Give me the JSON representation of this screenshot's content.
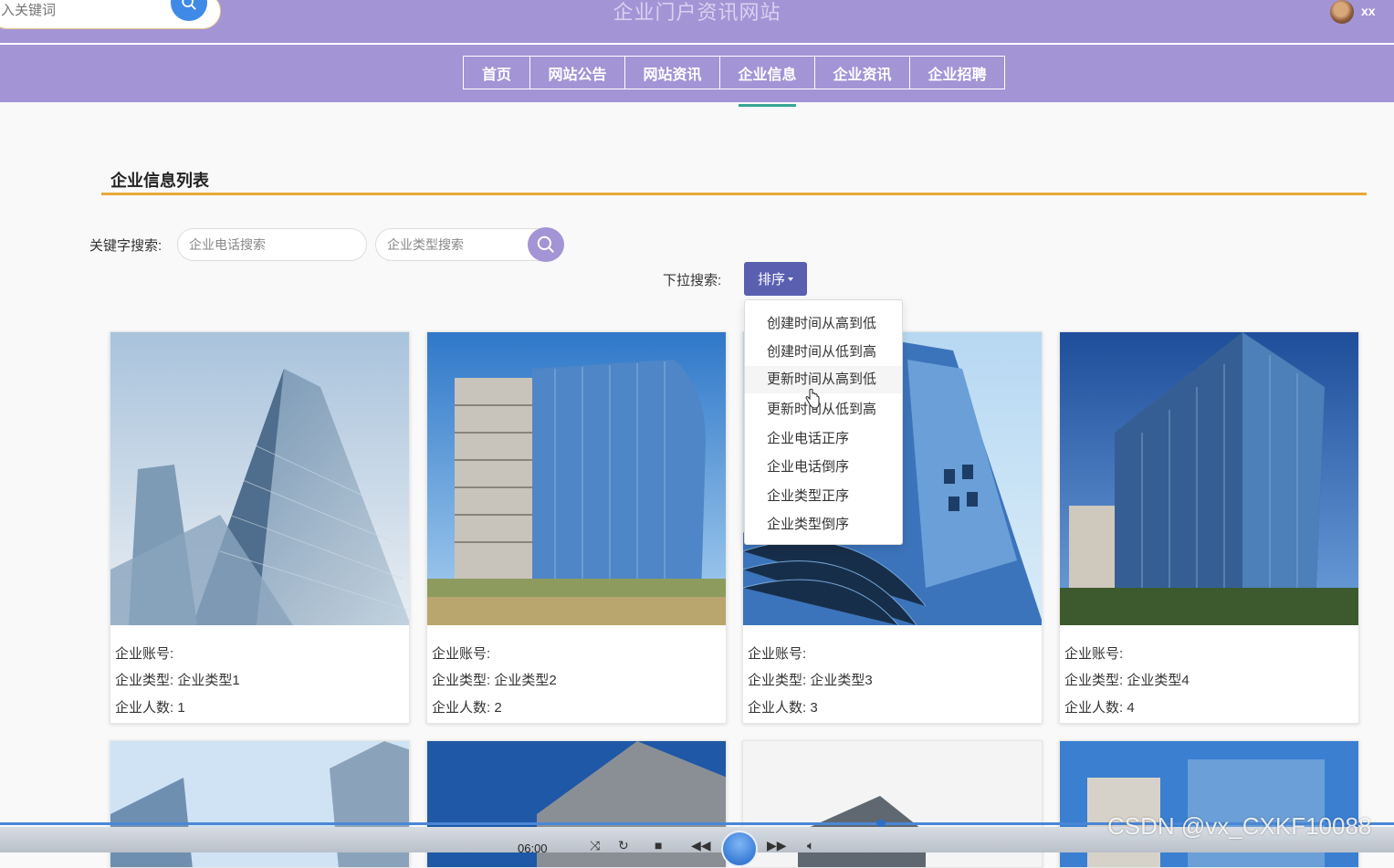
{
  "header": {
    "search_placeholder": "入关键词",
    "site_title": "企业门户资讯网站",
    "username": "xx"
  },
  "nav": [
    {
      "label": "首页"
    },
    {
      "label": "网站公告"
    },
    {
      "label": "网站资讯"
    },
    {
      "label": "企业信息",
      "active": true
    },
    {
      "label": "企业资讯"
    },
    {
      "label": "企业招聘"
    }
  ],
  "section": {
    "title": "企业信息列表"
  },
  "search": {
    "keyword_label": "关键字搜索:",
    "phone_placeholder": "企业电话搜索",
    "type_placeholder": "企业类型搜索",
    "dropdown_label": "下拉搜索:",
    "sort_label": "排序"
  },
  "sort_options": [
    "创建时间从高到低",
    "创建时间从低到高",
    "更新时间从高到低",
    "更新时间从低到高",
    "企业电话正序",
    "企业电话倒序",
    "企业类型正序",
    "企业类型倒序"
  ],
  "cards": [
    {
      "account_label": "企业账号:",
      "type_label": "企业类型:",
      "type_value": "企业类型1",
      "count_label": "企业人数:",
      "count_value": "1"
    },
    {
      "account_label": "企业账号:",
      "type_label": "企业类型:",
      "type_value": "企业类型2",
      "count_label": "企业人数:",
      "count_value": "2"
    },
    {
      "account_label": "企业账号:",
      "type_label": "企业类型:",
      "type_value": "企业类型3",
      "count_label": "企业人数:",
      "count_value": "3"
    },
    {
      "account_label": "企业账号:",
      "type_label": "企业类型:",
      "type_value": "企业类型4",
      "count_label": "企业人数:",
      "count_value": "4"
    }
  ],
  "player": {
    "time": "06:00"
  },
  "watermark": "CSDN @vx_CXKF10088",
  "colors": {
    "header_purple": "#a394d6",
    "accent_orange": "#e8a93a",
    "sort_button": "#5a5fb0",
    "nav_active_underline": "#3aa594"
  }
}
